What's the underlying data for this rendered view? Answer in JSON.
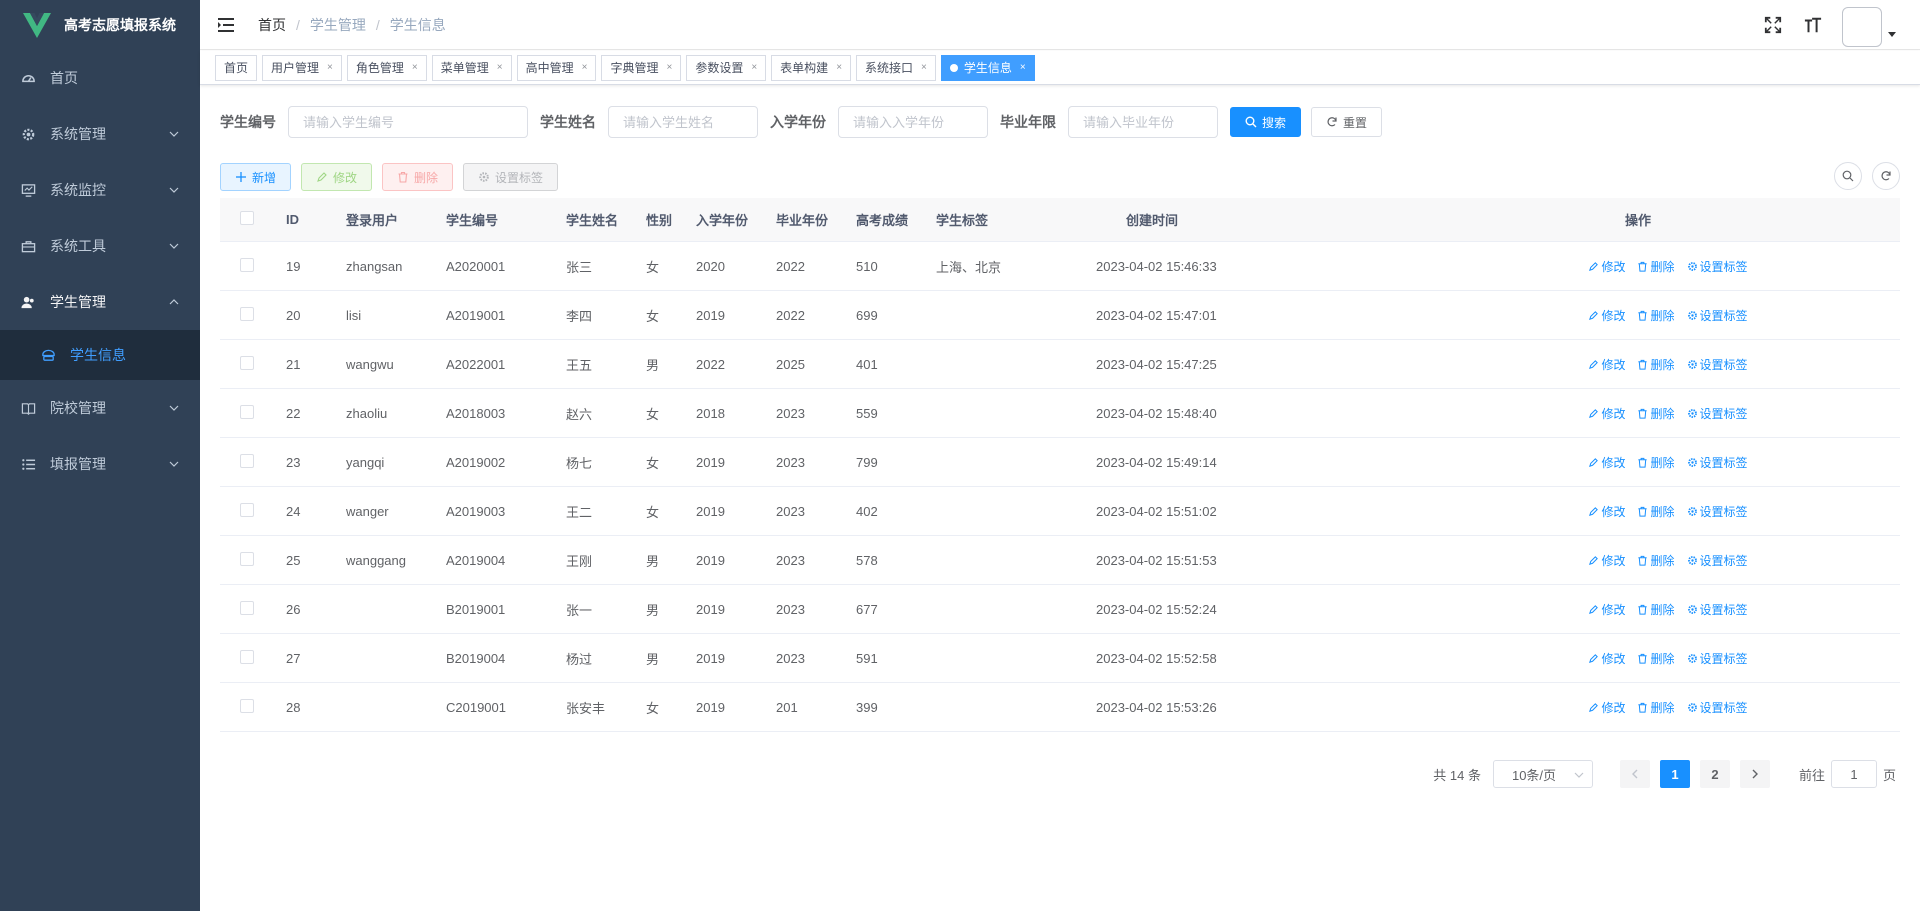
{
  "app": {
    "title": "高考志愿填报系统",
    "accent": "#1890ff",
    "sidebar_bg": "#304156"
  },
  "sidebar": {
    "items": [
      {
        "label": "首页",
        "icon": "dashboard-icon"
      },
      {
        "label": "系统管理",
        "icon": "gear-icon"
      },
      {
        "label": "系统监控",
        "icon": "monitor-icon"
      },
      {
        "label": "系统工具",
        "icon": "toolbox-icon"
      },
      {
        "label": "学生管理",
        "icon": "user-icon"
      },
      {
        "label": "院校管理",
        "icon": "book-icon"
      },
      {
        "label": "填报管理",
        "icon": "list-icon"
      }
    ],
    "sub_active": {
      "label": "学生信息",
      "icon": "student-icon"
    }
  },
  "breadcrumb": [
    "首页",
    "学生管理",
    "学生信息"
  ],
  "tags": [
    "首页",
    "用户管理",
    "角色管理",
    "菜单管理",
    "高中管理",
    "字典管理",
    "参数设置",
    "表单构建",
    "系统接口",
    "学生信息"
  ],
  "search": {
    "labels": [
      "学生编号",
      "学生姓名",
      "入学年份",
      "毕业年限"
    ],
    "placeholders": [
      "请输入学生编号",
      "请输入学生姓名",
      "请输入入学年份",
      "请输入毕业年份"
    ],
    "search_btn": "搜索",
    "reset_btn": "重置"
  },
  "toolbar": {
    "add": "新增",
    "edit": "修改",
    "delete": "删除",
    "tags": "设置标签"
  },
  "table": {
    "headers": [
      "ID",
      "登录用户",
      "学生编号",
      "学生姓名",
      "性别",
      "入学年份",
      "毕业年份",
      "高考成绩",
      "学生标签",
      "创建时间",
      "操作"
    ],
    "ops": [
      "修改",
      "删除",
      "设置标签"
    ],
    "rows": [
      [
        "19",
        "zhangsan",
        "A2020001",
        "张三",
        "女",
        "2020",
        "2022",
        "510",
        "上海、北京",
        "2023-04-02 15:46:33"
      ],
      [
        "20",
        "lisi",
        "A2019001",
        "李四",
        "女",
        "2019",
        "2022",
        "699",
        "",
        "2023-04-02 15:47:01"
      ],
      [
        "21",
        "wangwu",
        "A2022001",
        "王五",
        "男",
        "2022",
        "2025",
        "401",
        "",
        "2023-04-02 15:47:25"
      ],
      [
        "22",
        "zhaoliu",
        "A2018003",
        "赵六",
        "女",
        "2018",
        "2023",
        "559",
        "",
        "2023-04-02 15:48:40"
      ],
      [
        "23",
        "yangqi",
        "A2019002",
        "杨七",
        "女",
        "2019",
        "2023",
        "799",
        "",
        "2023-04-02 15:49:14"
      ],
      [
        "24",
        "wanger",
        "A2019003",
        "王二",
        "女",
        "2019",
        "2023",
        "402",
        "",
        "2023-04-02 15:51:02"
      ],
      [
        "25",
        "wanggang",
        "A2019004",
        "王刚",
        "男",
        "2019",
        "2023",
        "578",
        "",
        "2023-04-02 15:51:53"
      ],
      [
        "26",
        "",
        "B2019001",
        "张一",
        "男",
        "2019",
        "2023",
        "677",
        "",
        "2023-04-02 15:52:24"
      ],
      [
        "27",
        "",
        "B2019004",
        "杨过",
        "男",
        "2019",
        "2023",
        "591",
        "",
        "2023-04-02 15:52:58"
      ],
      [
        "28",
        "",
        "C2019001",
        "张安丰",
        "女",
        "2019",
        "201",
        "399",
        "",
        "2023-04-02 15:53:26"
      ]
    ]
  },
  "pagination": {
    "total": "共 14 条",
    "page_size": "10条/页",
    "pages": [
      "1",
      "2"
    ],
    "current": "1",
    "goto_prefix": "前往",
    "goto_value": "1",
    "goto_suffix": "页"
  }
}
